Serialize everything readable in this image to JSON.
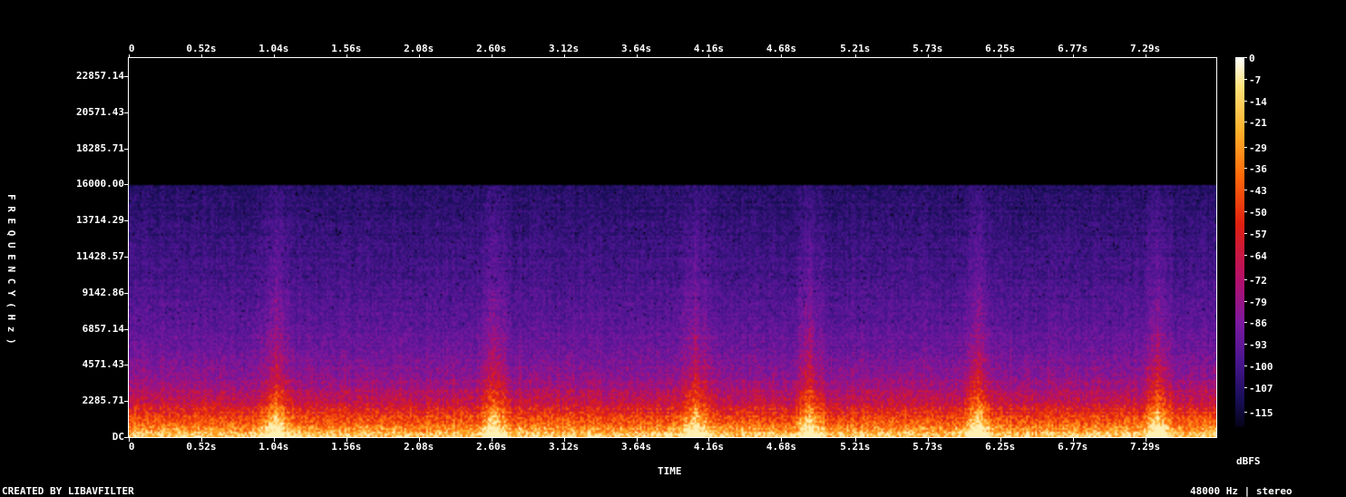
{
  "chart_data": {
    "type": "heatmap",
    "xlabel": "TIME",
    "ylabel": "FREQUENCY (Hz)",
    "x_ticks": [
      "0",
      "0.52s",
      "1.04s",
      "1.56s",
      "2.08s",
      "2.60s",
      "3.12s",
      "3.64s",
      "4.16s",
      "4.68s",
      "5.21s",
      "5.73s",
      "6.25s",
      "6.77s",
      "7.29s"
    ],
    "y_ticks": [
      "DC",
      "2285.71",
      "4571.43",
      "6857.14",
      "9142.86",
      "11428.57",
      "13714.29",
      "16000.00",
      "18285.71",
      "20571.43",
      "22857.14"
    ],
    "xlim_seconds": [
      0,
      7.8
    ],
    "ylim_hz": [
      0,
      24000
    ],
    "content_cutoff_hz": 16000,
    "colorbar": {
      "unit": "dBFS",
      "ticks": [
        "0",
        "-7",
        "-14",
        "-21",
        "-29",
        "-36",
        "-43",
        "-50",
        "-57",
        "-64",
        "-72",
        "-79",
        "-86",
        "-93",
        "-100",
        "-107",
        "-115"
      ],
      "range_dbfs": [
        -120,
        0
      ]
    }
  },
  "footer": {
    "credit": "CREATED BY LIBAVFILTER",
    "info": "48000 Hz | stereo"
  }
}
